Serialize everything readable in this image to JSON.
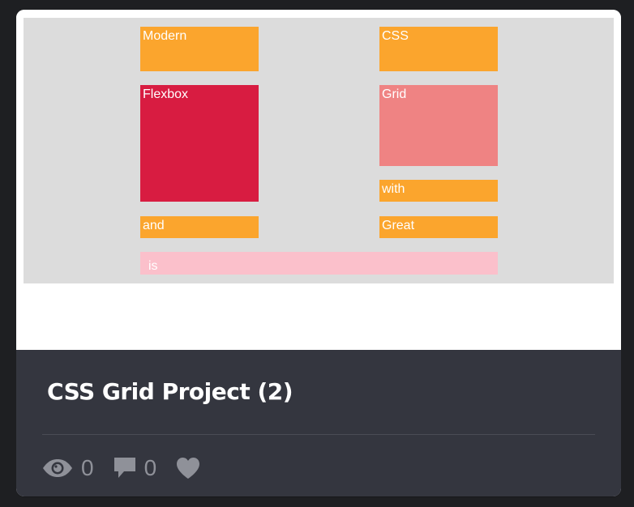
{
  "preview": {
    "boxes": {
      "modern": "Modern",
      "css": "CSS",
      "flexbox": "Flexbox",
      "grid": "Grid",
      "with": "with",
      "and": "and",
      "great": "Great",
      "is": "is"
    },
    "colors": {
      "stage": "#dcdcdc",
      "orange": "#fba52d",
      "crimson": "#d81c41",
      "salmon": "#ef8383",
      "pink": "#fbc0cb"
    }
  },
  "card": {
    "title": "CSS Grid Project (2)",
    "stats": {
      "views": {
        "icon": "eye-icon",
        "count": "0"
      },
      "comments": {
        "icon": "comment-icon",
        "count": "0"
      },
      "likes": {
        "icon": "heart-icon"
      }
    },
    "colors": {
      "footer": "#34363f",
      "stat_text": "#8f9199"
    }
  }
}
